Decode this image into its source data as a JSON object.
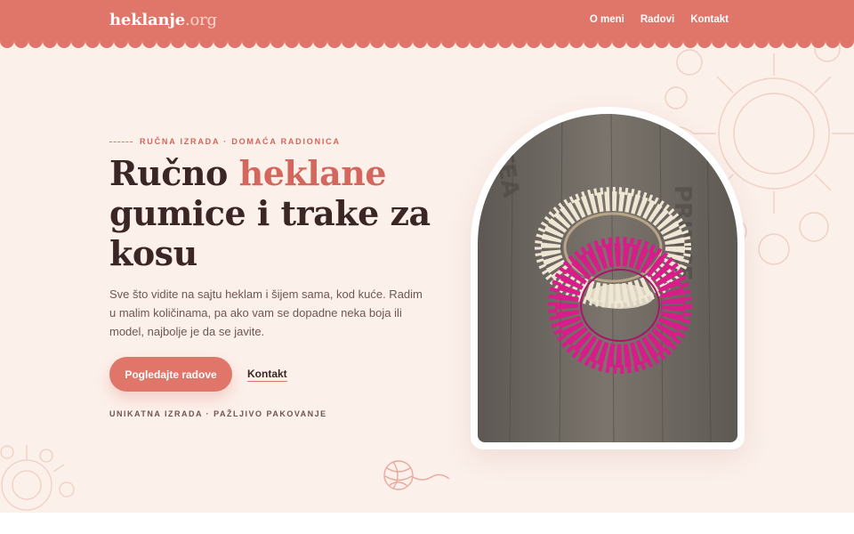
{
  "header": {
    "logo_main": "heklanje",
    "logo_ext": ".org",
    "nav": [
      "O meni",
      "Radovi",
      "Kontakt"
    ]
  },
  "hero": {
    "eyebrow": "RUČNA IZRADA · DOMAĆA RADIONICA",
    "headline_part1": "Ručno ",
    "headline_accent": "heklane",
    "headline_part2": "gumice i trake za kosu",
    "lead": "Sve što vidite na sajtu heklam i šijem sama, kod kuće. Radim u malim količinama, pa ako vam se dopadne neka boja ili model, najbolje je da se javite.",
    "cta_label": "Pogledajte radove",
    "link_label": "Kontakt",
    "tagline": "UNIKATNA IZRADA · PAŽLJIVO PAKOVANJE"
  },
  "photo": {
    "subject": "crocheted scrunchies",
    "colors": {
      "cream": "#efe6d3",
      "magenta": "#d81c8a",
      "wood": "#6f6962"
    }
  },
  "colors": {
    "accent": "#e0766a",
    "background": "#fcf0ea",
    "text": "#3b2626"
  },
  "icons": [
    "yarn-ball-icon"
  ]
}
